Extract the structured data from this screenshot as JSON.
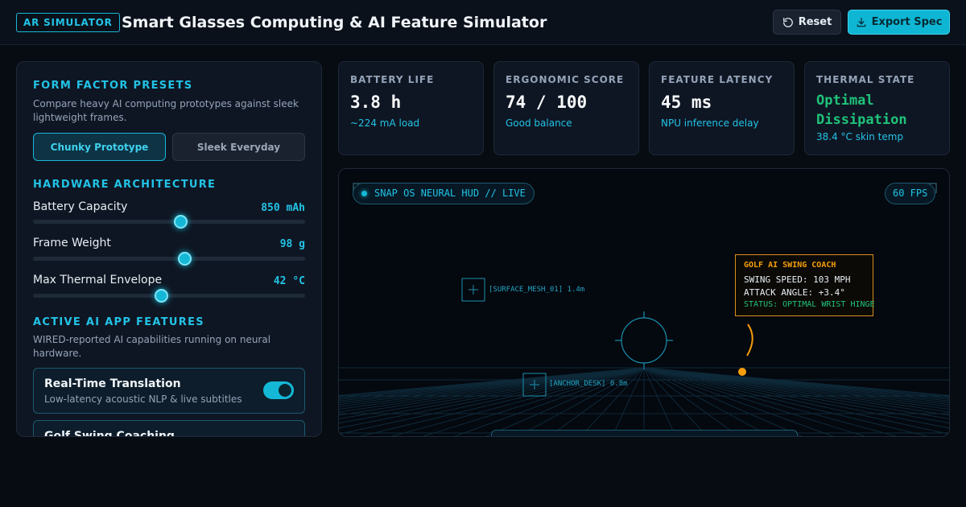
{
  "header": {
    "badge": "AR SIMULATOR",
    "title": "Smart Glasses Computing & AI Feature Simulator",
    "reset_label": "Reset",
    "export_label": "Export Spec"
  },
  "presets": {
    "title": "FORM FACTOR PRESETS",
    "description": "Compare heavy AI computing prototypes against sleek lightweight frames.",
    "options": [
      {
        "label": "Chunky Prototype",
        "active": true
      },
      {
        "label": "Sleek Everyday",
        "active": false
      }
    ]
  },
  "hardware": {
    "title": "HARDWARE ARCHITECTURE",
    "sliders": [
      {
        "label": "Battery Capacity",
        "value": "850 mAh",
        "fraction": 0.54
      },
      {
        "label": "Frame Weight",
        "value": "98 g",
        "fraction": 0.555
      },
      {
        "label": "Max Thermal Envelope",
        "value": "42 °C",
        "fraction": 0.47
      }
    ]
  },
  "ai_features": {
    "title": "ACTIVE AI APP FEATURES",
    "description": "WIRED-reported AI capabilities running on neural hardware.",
    "items": [
      {
        "name": "Real-Time Translation",
        "desc": "Low-latency acoustic NLP & live subtitles",
        "enabled": true
      },
      {
        "name": "Golf Swing Coaching",
        "desc": "",
        "enabled": true
      }
    ]
  },
  "metrics": [
    {
      "label": "BATTERY LIFE",
      "value": "3.8 h",
      "sub": "~224 mA load"
    },
    {
      "label": "ERGONOMIC SCORE",
      "value": "74 / 100",
      "sub": "Good balance"
    },
    {
      "label": "FEATURE LATENCY",
      "value": "45 ms",
      "sub": "NPU inference delay"
    },
    {
      "label": "THERMAL STATE",
      "value": "Optimal Dissipation",
      "sub": "38.4 °C skin temp"
    }
  ],
  "hud": {
    "status": "SNAP OS NEURAL HUD // LIVE",
    "fps": "60 FPS",
    "mesh_labels": [
      "[SURFACE_MESH_01] 1.4m",
      "[ANCHOR_DESK] 0.8m"
    ],
    "coach": {
      "title": "GOLF AI SWING COACH",
      "lines": [
        "SWING SPEED: 103 MPH",
        "ATTACK ANGLE: +3.4°"
      ],
      "status": "STATUS: OPTIMAL WRIST HINGE"
    }
  },
  "colors": {
    "accent": "#14b8d6",
    "warning": "#f59e0b",
    "success": "#1fc27a",
    "background": "#070b12"
  }
}
